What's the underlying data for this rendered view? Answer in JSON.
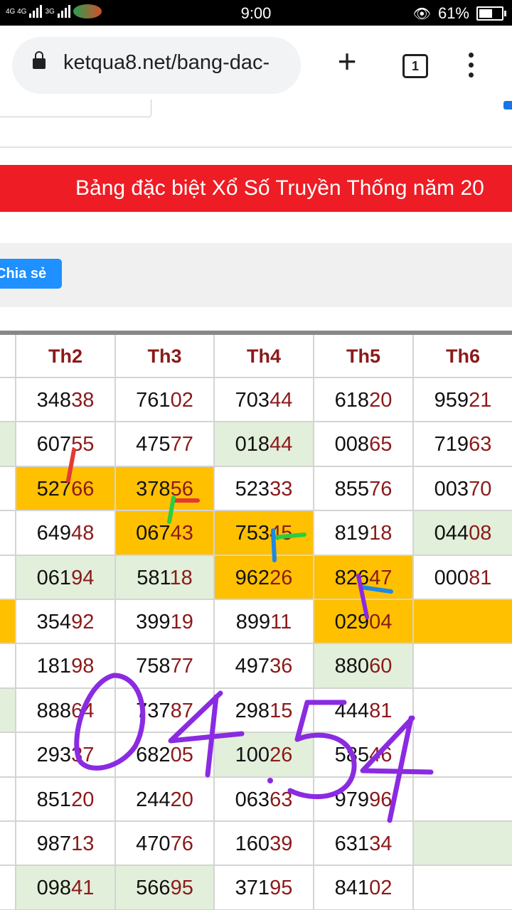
{
  "status": {
    "network_left": "4G 4G",
    "network_right": "3G",
    "time": "9:00",
    "battery_percent": "61%",
    "battery_level": 0.61
  },
  "browser": {
    "url": "ketqua8.net/bang-dac-",
    "tab_count": "1",
    "icons": [
      "lock-icon",
      "plus-icon",
      "tabs-icon",
      "menu-icon"
    ]
  },
  "banner": {
    "text": "Bảng đặc biệt Xổ Số Truyền Thống năm 20",
    "color": "#ee1c24"
  },
  "share": {
    "label": "Chia sẻ",
    "color": "#1e90ff"
  },
  "table": {
    "headers": [
      "Th2",
      "Th3",
      "Th4",
      "Th5",
      "Th6"
    ],
    "rows": [
      [
        {
          "v": "34838",
          "bg": ""
        },
        {
          "v": "76102",
          "bg": ""
        },
        {
          "v": "70344",
          "bg": ""
        },
        {
          "v": "61820",
          "bg": ""
        },
        {
          "v": "95921",
          "bg": ""
        }
      ],
      [
        {
          "v": "60755",
          "bg": ""
        },
        {
          "v": "47577",
          "bg": ""
        },
        {
          "v": "01844",
          "bg": "green"
        },
        {
          "v": "00865",
          "bg": ""
        },
        {
          "v": "71963",
          "bg": ""
        }
      ],
      [
        {
          "v": "52766",
          "bg": "orange"
        },
        {
          "v": "37856",
          "bg": "orange"
        },
        {
          "v": "52333",
          "bg": ""
        },
        {
          "v": "85576",
          "bg": ""
        },
        {
          "v": "00370",
          "bg": ""
        }
      ],
      [
        {
          "v": "64948",
          "bg": ""
        },
        {
          "v": "06743",
          "bg": "orange"
        },
        {
          "v": "75345",
          "bg": "orange"
        },
        {
          "v": "81918",
          "bg": ""
        },
        {
          "v": "04408",
          "bg": "green"
        }
      ],
      [
        {
          "v": "06194",
          "bg": "green"
        },
        {
          "v": "58118",
          "bg": "green"
        },
        {
          "v": "96226",
          "bg": "orange"
        },
        {
          "v": "82647",
          "bg": "orange"
        },
        {
          "v": "00081",
          "bg": ""
        }
      ],
      [
        {
          "v": "35492",
          "bg": ""
        },
        {
          "v": "39919",
          "bg": ""
        },
        {
          "v": "89911",
          "bg": ""
        },
        {
          "v": "02904",
          "bg": "orange"
        },
        {
          "v": "",
          "bg": "orange"
        }
      ],
      [
        {
          "v": "18198",
          "bg": ""
        },
        {
          "v": "75877",
          "bg": ""
        },
        {
          "v": "49736",
          "bg": ""
        },
        {
          "v": "88060",
          "bg": "green"
        },
        {
          "v": "",
          "bg": ""
        }
      ],
      [
        {
          "v": "88864",
          "bg": ""
        },
        {
          "v": "73787",
          "bg": ""
        },
        {
          "v": "29815",
          "bg": ""
        },
        {
          "v": "44481",
          "bg": ""
        },
        {
          "v": "",
          "bg": ""
        }
      ],
      [
        {
          "v": "29337",
          "bg": ""
        },
        {
          "v": "68205",
          "bg": ""
        },
        {
          "v": "10026",
          "bg": "green"
        },
        {
          "v": "58546",
          "bg": ""
        },
        {
          "v": "",
          "bg": ""
        }
      ],
      [
        {
          "v": "85120",
          "bg": ""
        },
        {
          "v": "24420",
          "bg": ""
        },
        {
          "v": "06363",
          "bg": ""
        },
        {
          "v": "97996",
          "bg": ""
        },
        {
          "v": "",
          "bg": ""
        }
      ],
      [
        {
          "v": "98713",
          "bg": ""
        },
        {
          "v": "47076",
          "bg": ""
        },
        {
          "v": "16039",
          "bg": ""
        },
        {
          "v": "63134",
          "bg": ""
        },
        {
          "v": "",
          "bg": "green"
        }
      ],
      [
        {
          "v": "09841",
          "bg": "green"
        },
        {
          "v": "56695",
          "bg": "green"
        },
        {
          "v": "37195",
          "bg": ""
        },
        {
          "v": "84102",
          "bg": ""
        },
        {
          "v": "",
          "bg": ""
        }
      ]
    ],
    "left_partial_col_bg": [
      "",
      "green",
      "",
      "",
      "",
      "orange",
      "",
      "green",
      "",
      "",
      "",
      ""
    ]
  },
  "handwriting": {
    "text": "04.54",
    "color": "#8a2be2"
  }
}
